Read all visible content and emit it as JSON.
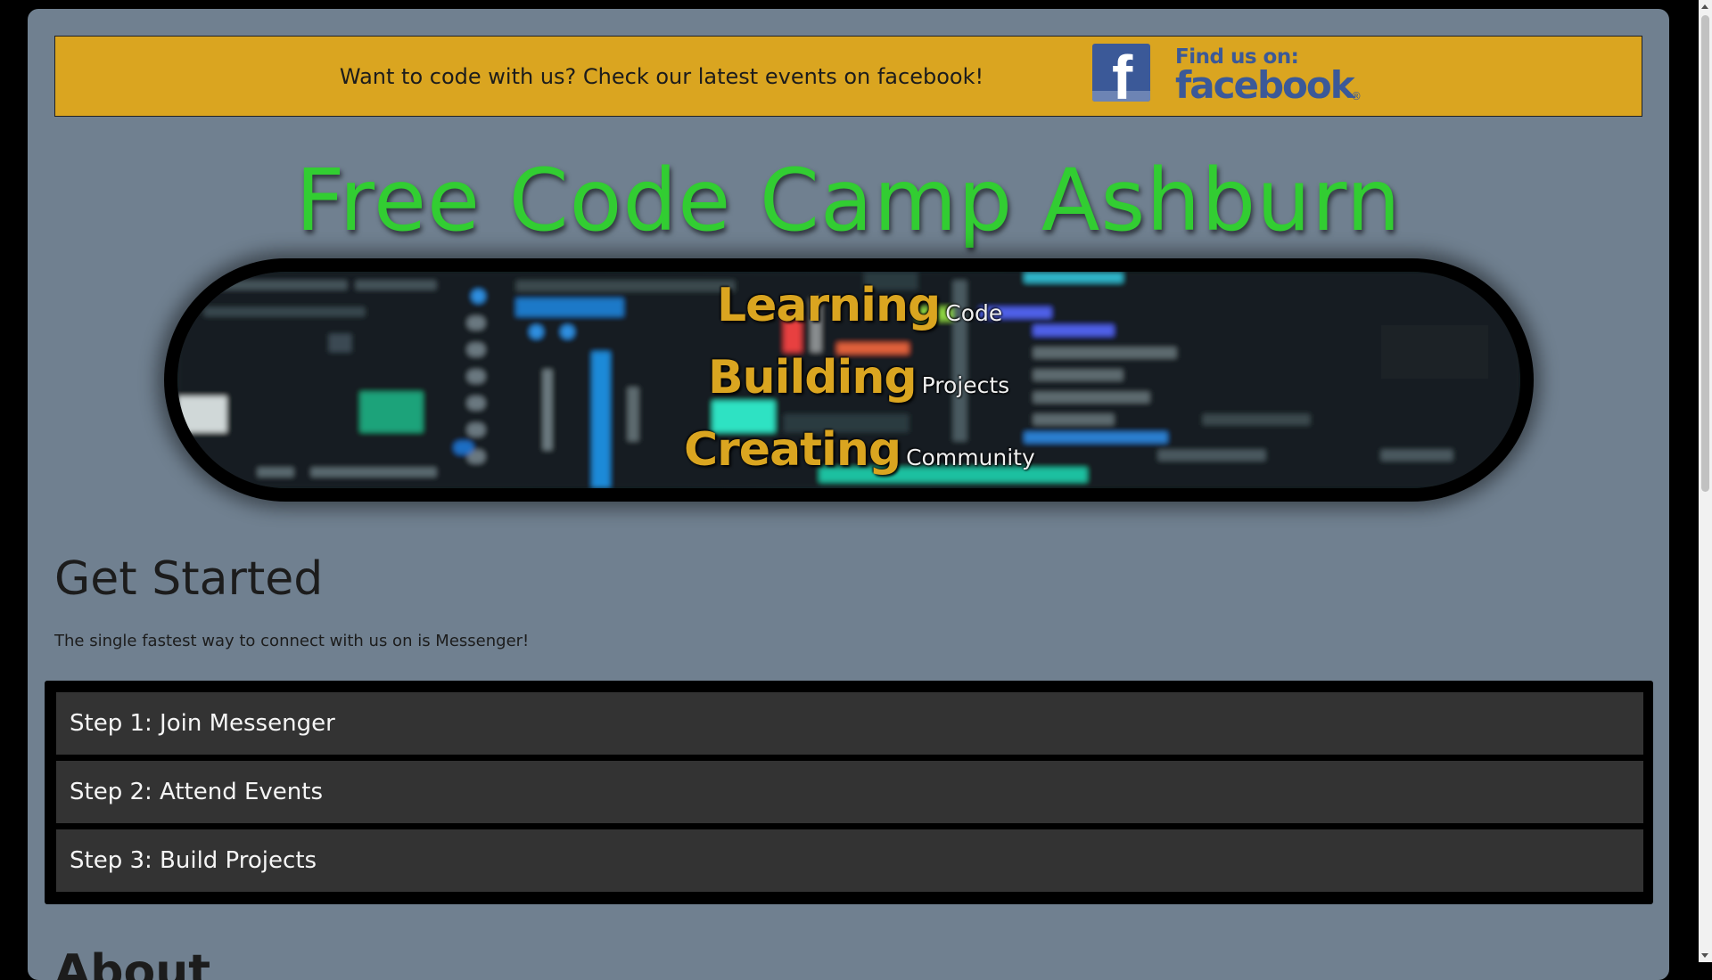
{
  "banner": {
    "text": "Want to code with us? Check our latest events on facebook!",
    "logo_find": "Find us on:",
    "logo_word": "facebook",
    "logo_reg": "®",
    "logo_letter": "f"
  },
  "site": {
    "title": "Free Code Camp Ashburn"
  },
  "hero": {
    "rows": [
      {
        "big": "Learning",
        "small": "Code"
      },
      {
        "big": "Building",
        "small": "Projects"
      },
      {
        "big": "Creating",
        "small": "Community"
      }
    ]
  },
  "get_started": {
    "title": "Get Started",
    "text": "The single fastest way to connect with us on is Messenger!"
  },
  "steps": [
    {
      "label": "Step 1: Join Messenger"
    },
    {
      "label": "Step 2: Attend Events"
    },
    {
      "label": "Step 3: Build Projects"
    }
  ],
  "about": {
    "title": "About"
  },
  "colors": {
    "page_bg": "#708090",
    "banner_bg": "#daa520",
    "title_green": "#32cd32",
    "hero_gold": "#daa520",
    "step_bg": "#333333",
    "facebook_blue": "#3b5998"
  },
  "icons": {
    "facebook_logo": "facebook-logo-icon"
  }
}
